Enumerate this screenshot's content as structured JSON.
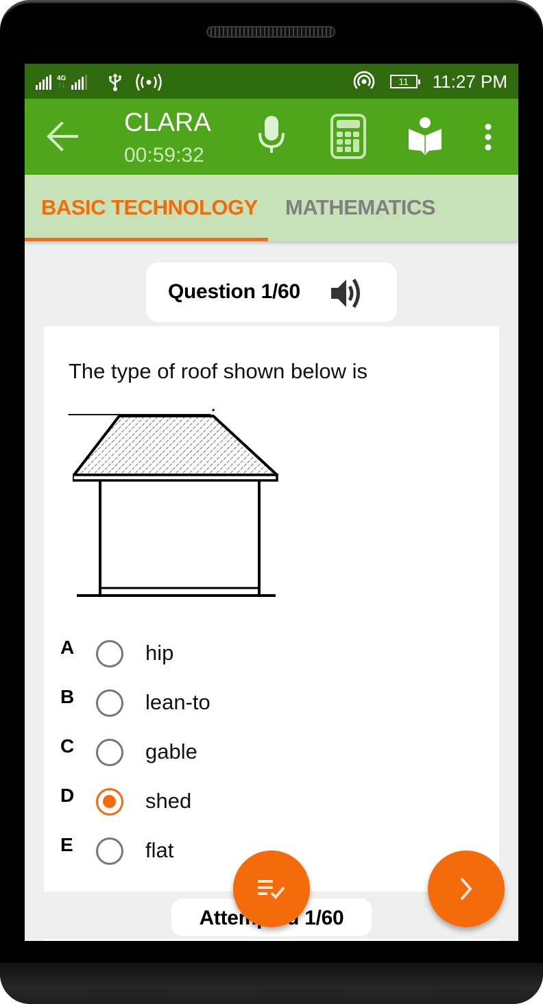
{
  "status_bar": {
    "network_type": "4G",
    "battery_level": "11",
    "time": "11:27 PM",
    "icons": [
      "signal-icon",
      "network-4g-icon",
      "signal-icon",
      "usb-icon",
      "hotspot-icon",
      "wireless-broadcast-icon",
      "battery-icon"
    ]
  },
  "app_bar": {
    "title": "CLARA",
    "timer": "00:59:32",
    "icons": [
      "back-arrow-icon",
      "microphone-icon",
      "calculator-icon",
      "reading-book-icon",
      "more-vert-icon"
    ]
  },
  "tabs": [
    {
      "label": "BASIC TECHNOLOGY",
      "active": true
    },
    {
      "label": "MATHEMATICS",
      "active": false
    }
  ],
  "question": {
    "header": "Question 1/60",
    "text": "The type of roof shown below is",
    "blank": "____________.",
    "image_description": "house with hatched hip roof",
    "options": [
      {
        "letter": "A",
        "text": "hip",
        "selected": false
      },
      {
        "letter": "B",
        "text": "lean-to",
        "selected": false
      },
      {
        "letter": "C",
        "text": "gable",
        "selected": false
      },
      {
        "letter": "D",
        "text": "shed",
        "selected": true
      },
      {
        "letter": "E",
        "text": "flat",
        "selected": false
      }
    ]
  },
  "footer": {
    "attempted": "Attempted 1/60"
  },
  "colors": {
    "status_bar": "#2f6a0f",
    "app_bar": "#4ea61a",
    "tab_bar": "#c7e2b6",
    "accent": "#f56b0b",
    "inactive_tab": "#808080"
  }
}
